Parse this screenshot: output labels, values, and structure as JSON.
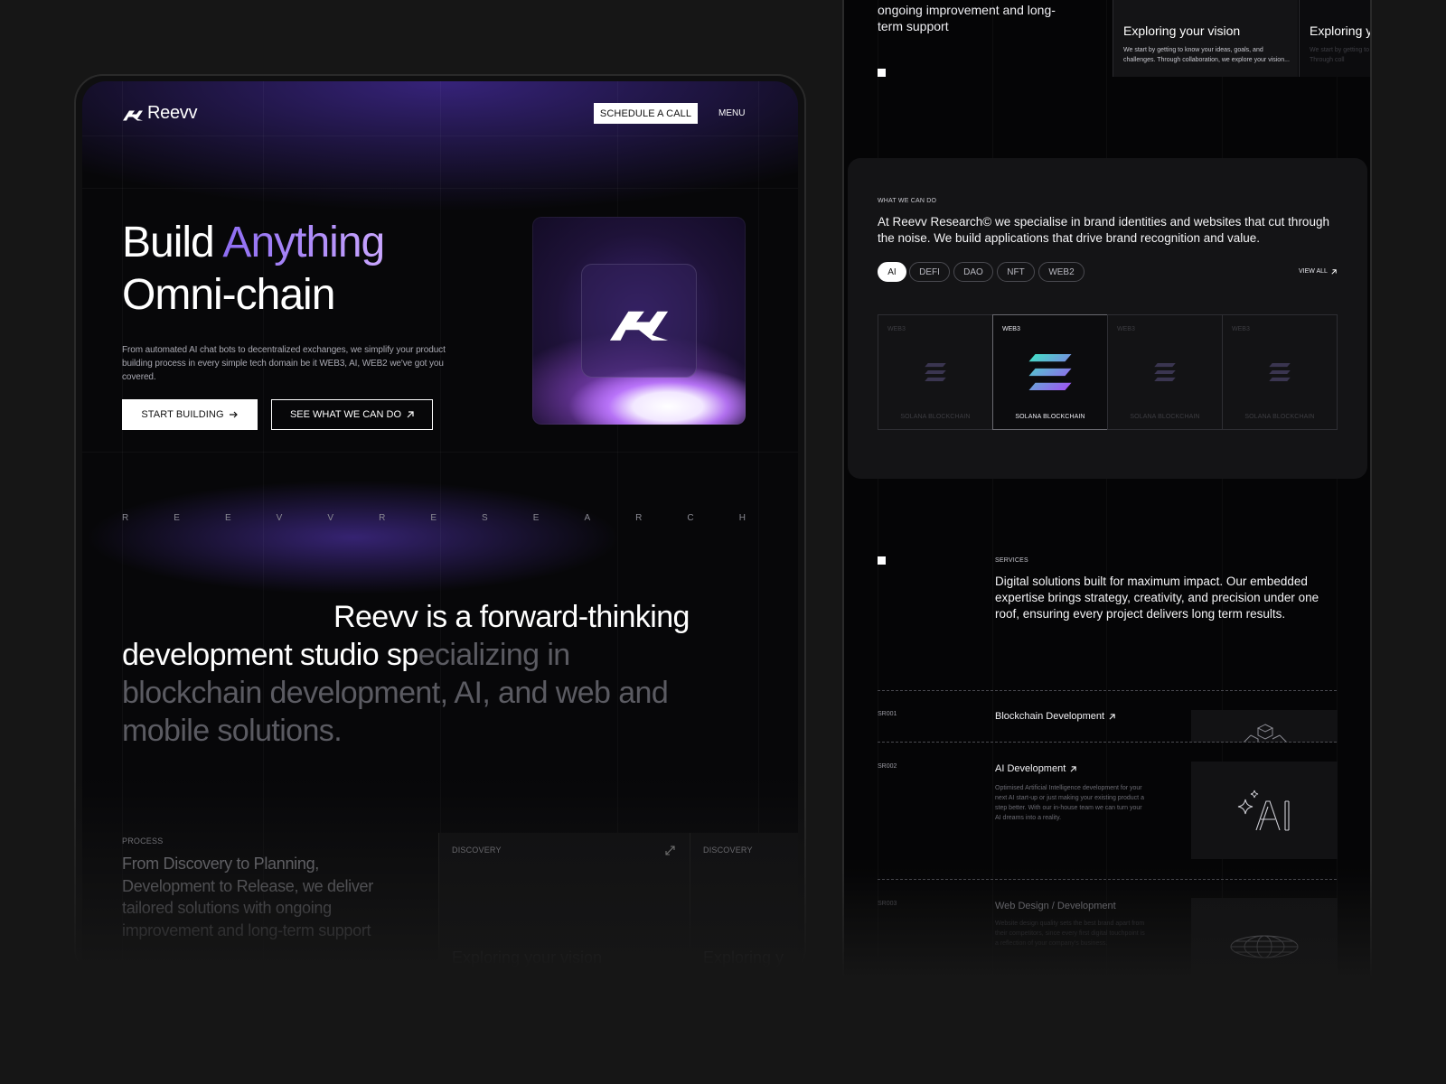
{
  "left": {
    "brand": "Reevv",
    "nav": {
      "schedule_label": "SCHEDULE A CALL",
      "menu_label": "MENU"
    },
    "hero": {
      "title_part1": "Build ",
      "title_accent": "Anything",
      "title_line2": "Omni-chain",
      "description": "From automated AI chat bots to decentralized exchanges, we simplify your product building process in every simple tech domain be it WEB3, AI, WEB2 we've got you covered.",
      "start_label": "START BUILDING",
      "see_label": "SEE WHAT WE CAN DO"
    },
    "spaced_letters": [
      "R",
      "E",
      "E",
      "V",
      "V",
      "R",
      "E",
      "S",
      "E",
      "A",
      "R",
      "C",
      "H"
    ],
    "statement": {
      "line1": "Reevv is a forward-thinking",
      "line2_bright": "development studio sp",
      "line2_dim": "ecializing in",
      "line3": "blockchain development, AI, and web and",
      "line4": "mobile solutions."
    },
    "process": {
      "label": "PROCESS",
      "text": "From Discovery to Planning, Development to Release, we deliver tailored solutions with ongoing improvement and long-term support",
      "cards": [
        {
          "label": "DISCOVERY",
          "title": "Exploring your vision"
        },
        {
          "label": "DISCOVERY",
          "title": "Exploring y"
        }
      ]
    }
  },
  "right": {
    "top": {
      "text": "ongoing improvement and long-term support",
      "cards": [
        {
          "title": "Exploring your vision",
          "desc": "We start by getting to know your ideas, goals, and challenges. Through collaboration, we explore your vision..."
        },
        {
          "title": "Exploring y",
          "desc": "We start by getting to kn challenges. Through coll"
        }
      ]
    },
    "what": {
      "label": "WHAT WE CAN DO",
      "text": "At Reevv Research© we specialise in brand identities and websites that cut through the noise. We build applications that drive brand recognition and value.",
      "tabs": [
        "AI",
        "DEFI",
        "DAO",
        "NFT",
        "WEB2"
      ],
      "active_tab": "AI",
      "view_all_label": "VIEW ALL",
      "cards": [
        {
          "tag": "WEB3",
          "name": "SOLANA BLOCKCHAIN",
          "active": false
        },
        {
          "tag": "WEB3",
          "name": "SOLANA BLOCKCHAIN",
          "active": true
        },
        {
          "tag": "WEB3",
          "name": "SOLANA BLOCKCHAIN",
          "active": false
        },
        {
          "tag": "WEB3",
          "name": "SOLANA BLOCKCHAIN",
          "active": false
        }
      ]
    },
    "services": {
      "label": "SERVICES",
      "text": "Digital solutions built for maximum impact. Our embedded expertise brings strategy, creativity, and precision under one roof, ensuring every project delivers long term results.",
      "items": [
        {
          "code": "SR001",
          "title": "Blockchain Development"
        },
        {
          "code": "SR002",
          "title": "AI Development",
          "desc": "Optimised Artificial Intelligence development for your next AI start-up or just making your existing product a step better. With our in-house team we can turn your AI dreams into a reality."
        },
        {
          "code": "SR003",
          "title": "Web Design / Development",
          "desc": "Website design quality sets the best brand apart from their competitors, since every first digital touchpoint is a reflection of your company's business."
        }
      ]
    }
  },
  "colors": {
    "accent": "#8d6cf2",
    "background": "#161616",
    "screen": "#070709"
  }
}
